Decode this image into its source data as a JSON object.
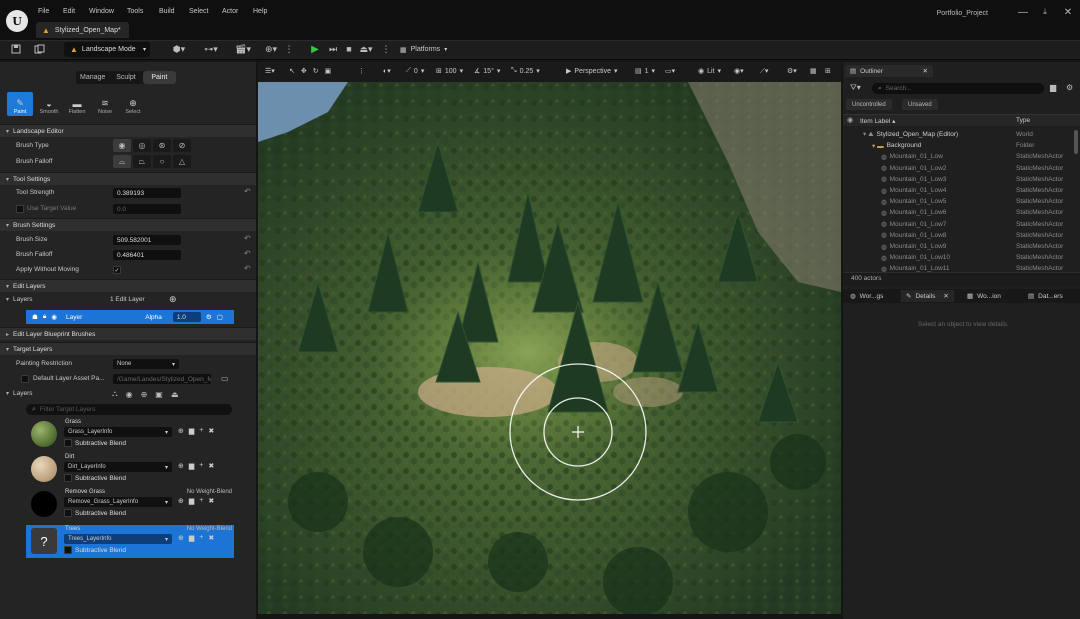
{
  "app": {
    "logo_text": "U",
    "menu": [
      "File",
      "Edit",
      "Window",
      "Tools",
      "Build",
      "Select",
      "Actor",
      "Help"
    ],
    "document_tab": "Stylized_Open_Map*",
    "project_name": "Portfolio_Project",
    "window_buttons": [
      "—",
      "⤓",
      "□",
      "✕"
    ]
  },
  "toolbar": {
    "mode_label": "Landscape Mode",
    "platforms_label": "Platforms"
  },
  "landscape": {
    "mode_tabs": [
      {
        "label": "Manage",
        "active": false
      },
      {
        "label": "Sculpt",
        "active": false
      },
      {
        "label": "Paint",
        "active": true
      }
    ],
    "tools": [
      {
        "label": "Paint",
        "icon": "brush-icon",
        "glyph": "✎",
        "active": true
      },
      {
        "label": "Smooth",
        "icon": "smooth-icon",
        "glyph": "◒",
        "active": false
      },
      {
        "label": "Flatten",
        "icon": "flatten-icon",
        "glyph": "▬",
        "active": false
      },
      {
        "label": "Noise",
        "icon": "noise-icon",
        "glyph": "≋",
        "active": false
      },
      {
        "label": "Select",
        "icon": "select-icon",
        "glyph": "⊕",
        "active": false
      }
    ],
    "sections": {
      "landscape_editor": "Landscape Editor",
      "tool_settings": "Tool Settings",
      "brush_settings": "Brush Settings",
      "edit_layers": "Edit Layers",
      "edit_layer_blueprint_brushes": "Edit Layer Blueprint Brushes",
      "target_layers": "Target Layers"
    },
    "brush_type_label": "Brush Type",
    "brush_falloff_type_label": "Brush Falloff",
    "tool_strength_label": "Tool Strength",
    "tool_strength_value": "0.389193",
    "use_target_value_label": "Use Target Value",
    "target_value": "0.0",
    "brush_size_label": "Brush Size",
    "brush_size_value": "509.582001",
    "brush_falloff_label": "Brush Falloff",
    "brush_falloff_value": "0.486401",
    "apply_without_moving_label": "Apply Without Moving",
    "layers_label": "Layers",
    "edit_layer_count": "1 Edit Layer",
    "layer_name": "Layer",
    "alpha_label": "Alpha",
    "alpha_value": "1.0",
    "painting_restriction_label": "Painting Restriction",
    "painting_restriction_value": "None",
    "default_layer_asset_label": "Default Layer Asset Pa...",
    "default_layer_asset_value": "/Game/Landes/Stylized_Open_M",
    "target_layers_label": "Layers",
    "filter_placeholder": "Filter Target Layers",
    "target_layers": [
      {
        "name": "Grass",
        "info": "Grass_LayerInfo",
        "blend": "Subtractive Blend",
        "no_weight": "",
        "thumb": "grass",
        "selected": false
      },
      {
        "name": "Dirt",
        "info": "Dirt_LayerInfo",
        "blend": "Subtractive Blend",
        "no_weight": "",
        "thumb": "dirt",
        "selected": false
      },
      {
        "name": "Remove Grass",
        "info": "Remove_Grass_LayerInfo",
        "blend": "Subtractive Blend",
        "no_weight": "No Weight-Blend",
        "thumb": "black",
        "selected": false
      },
      {
        "name": "Trees",
        "info": "Trees_LayerInfo",
        "blend": "Subtractive Blend",
        "no_weight": "No Weight-Blend",
        "thumb": "question",
        "selected": true
      }
    ]
  },
  "viewport": {
    "view_mode": "Perspective",
    "lit_label": "Lit",
    "rotation_snap": "15°",
    "scale_snap": "0.25",
    "location_snap": "100",
    "angle_value": "0",
    "camera_speed": "1"
  },
  "outliner": {
    "tab_label": "Outliner",
    "search_placeholder": "Search...",
    "filters": [
      "Uncontrolled",
      "Unsaved"
    ],
    "col_label": "Item Label",
    "col_type": "Type",
    "rows": [
      {
        "label": "Stylized_Open_Map (Editor)",
        "type": "World",
        "indent": 0,
        "kind": "world"
      },
      {
        "label": "Background",
        "type": "Folder",
        "indent": 1,
        "kind": "folder"
      },
      {
        "label": "Mountain_01_Low",
        "type": "StaticMeshActor",
        "indent": 2,
        "kind": "mesh"
      },
      {
        "label": "Mountain_01_Low2",
        "type": "StaticMeshActor",
        "indent": 2,
        "kind": "mesh"
      },
      {
        "label": "Mountain_01_Low3",
        "type": "StaticMeshActor",
        "indent": 2,
        "kind": "mesh"
      },
      {
        "label": "Mountain_01_Low4",
        "type": "StaticMeshActor",
        "indent": 2,
        "kind": "mesh"
      },
      {
        "label": "Mountain_01_Low5",
        "type": "StaticMeshActor",
        "indent": 2,
        "kind": "mesh"
      },
      {
        "label": "Mountain_01_Low6",
        "type": "StaticMeshActor",
        "indent": 2,
        "kind": "mesh"
      },
      {
        "label": "Mountain_01_Low7",
        "type": "StaticMeshActor",
        "indent": 2,
        "kind": "mesh"
      },
      {
        "label": "Mountain_01_Low8",
        "type": "StaticMeshActor",
        "indent": 2,
        "kind": "mesh"
      },
      {
        "label": "Mountain_01_Low9",
        "type": "StaticMeshActor",
        "indent": 2,
        "kind": "mesh"
      },
      {
        "label": "Mountain_01_Low10",
        "type": "StaticMeshActor",
        "indent": 2,
        "kind": "mesh"
      },
      {
        "label": "Mountain_01_Low11",
        "type": "StaticMeshActor",
        "indent": 2,
        "kind": "mesh"
      }
    ],
    "actor_count": "400 actors"
  },
  "details": {
    "tabs": [
      "World Settings",
      "Details",
      "World Partition",
      "Data Layers"
    ],
    "tab_display": [
      "Wor...gs",
      "Details",
      "Wo...ion",
      "Dat...ers"
    ],
    "empty_text": "Select an object to view details."
  },
  "colors": {
    "accent_blue": "#1c74d6",
    "play_green": "#2ecc40",
    "panel_bg": "#242424",
    "warning_orange": "#e0a030"
  }
}
